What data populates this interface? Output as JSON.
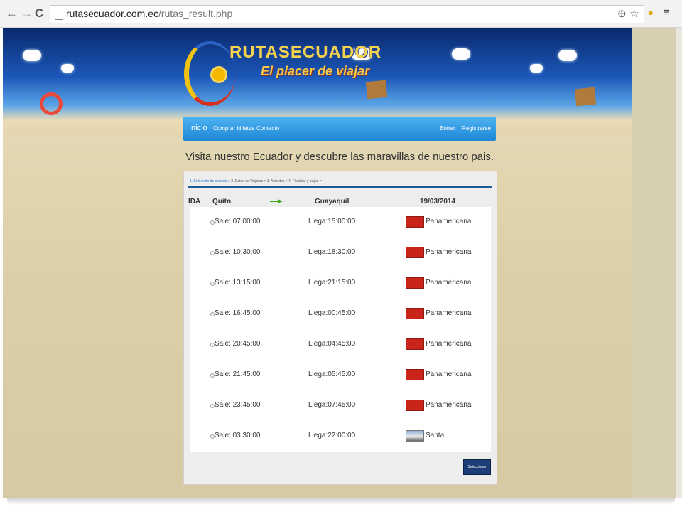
{
  "browser": {
    "back_icon": "←",
    "forward_icon": "→",
    "reload_icon": "C",
    "url_domain": "rutasecuador.com.ec",
    "url_path": "/rutas_result.php",
    "zoom_icon": "⊕",
    "star_icon": "☆",
    "menu_icon": "≡"
  },
  "site": {
    "logo_title": "RUTASECUADOR",
    "logo_tagline": "El placer de viajar"
  },
  "menu": {
    "home": "Inicio",
    "buy": "Comprar billetes",
    "contact": "Contacto",
    "login": "Entrar",
    "register": "Registrarse"
  },
  "headline": "Visita nuestro Ecuador y descubre las maravillas de nuestro pais.",
  "steps": {
    "step1": "1. Selección de servicio >",
    "step2": "2. Datos de Viajeros >",
    "step3": "3. Asientos >",
    "step4": "4. Finalizar y pagar >"
  },
  "trip": {
    "direction": "IDA",
    "origin": "Quito",
    "destination": "Guayaquil",
    "date": "19/03/2014"
  },
  "results": [
    {
      "sale": "Sale: 07:00:00",
      "llega": "Llega:15:00:00",
      "company": "Panamericana"
    },
    {
      "sale": "Sale: 10:30:00",
      "llega": "Llega:18:30:00",
      "company": "Panamericana"
    },
    {
      "sale": "Sale: 13:15:00",
      "llega": "Llega:21:15:00",
      "company": "Panamericana"
    },
    {
      "sale": "Sale: 16:45:00",
      "llega": "Llega:00:45:00",
      "company": "Panamericana"
    },
    {
      "sale": "Sale: 20:45:00",
      "llega": "Llega:04:45:00",
      "company": "Panamericana"
    },
    {
      "sale": "Sale: 21:45:00",
      "llega": "Llega:05:45:00",
      "company": "Panamericana"
    },
    {
      "sale": "Sale: 23:45:00",
      "llega": "Llega:07:45:00",
      "company": "Panamericana"
    },
    {
      "sale": "Sale: 03:30:00",
      "llega": "Llega:22:00:00",
      "company": "Santa"
    }
  ],
  "select_button": "Seleccionar",
  "colors": {
    "menu_blue": "#1e86d6",
    "button_navy": "#1c3d75",
    "step_line": "#1c5a9a",
    "arrow_green": "#3aa619",
    "panamericana_red": "#c9251b"
  }
}
